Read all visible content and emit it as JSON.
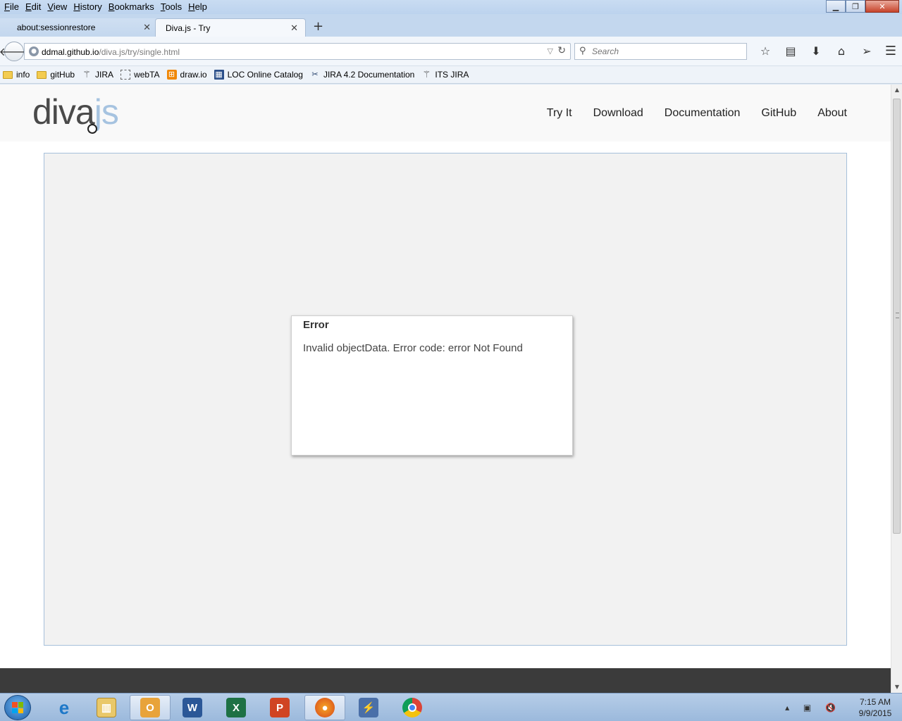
{
  "menubar": {
    "items": [
      "File",
      "Edit",
      "View",
      "History",
      "Bookmarks",
      "Tools",
      "Help"
    ]
  },
  "tabs": [
    {
      "label": "about:sessionrestore"
    },
    {
      "label": "Diva.js - Try"
    }
  ],
  "navbar": {
    "url_host": "ddmal.github.io",
    "url_path": "/diva.js/try/single.html",
    "search_placeholder": "Search"
  },
  "bookmarks": [
    {
      "label": "info",
      "icon": "folder-icon"
    },
    {
      "label": "gitHub",
      "icon": "folder-icon"
    },
    {
      "label": "JIRA",
      "icon": "jira-icon"
    },
    {
      "label": "webTA",
      "icon": "page-icon"
    },
    {
      "label": "draw.io",
      "icon": "drawio-icon"
    },
    {
      "label": "LOC Online Catalog",
      "icon": "loc-icon"
    },
    {
      "label": "JIRA 4.2 Documentation",
      "icon": "scissors-icon"
    },
    {
      "label": "ITS JIRA",
      "icon": "jira-icon"
    }
  ],
  "site": {
    "logo_main": "diva",
    "logo_accent": "js",
    "nav": [
      "Try It",
      "Download",
      "Documentation",
      "GitHub",
      "About"
    ]
  },
  "error": {
    "title": "Error",
    "message": "Invalid objectData. Error code: error Not Found"
  },
  "taskbar": {
    "apps": [
      "internet-explorer",
      "file-explorer",
      "outlook",
      "word",
      "excel",
      "powerpoint",
      "firefox",
      "network",
      "chrome"
    ],
    "time": "7:15 AM",
    "date": "9/9/2015"
  },
  "colors": {
    "logo_accent": "#a6c3e0",
    "viewer_bg": "#f2f2f2",
    "viewer_border": "#a6c0db",
    "footer": "#3b3b3b"
  }
}
